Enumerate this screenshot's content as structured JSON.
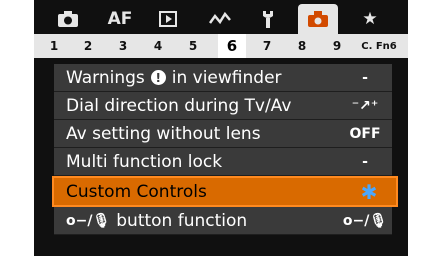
{
  "tabs": [
    {
      "name": "camera-icon",
      "label": ""
    },
    {
      "name": "af-tab",
      "label": "AF"
    },
    {
      "name": "playback-icon",
      "label": ""
    },
    {
      "name": "wave-icon",
      "label": ""
    },
    {
      "name": "wrench-icon",
      "label": ""
    },
    {
      "name": "custom-functions-icon",
      "label": "",
      "active": true
    },
    {
      "name": "star-icon",
      "label": "★"
    }
  ],
  "pages": [
    "1",
    "2",
    "3",
    "4",
    "5",
    "6",
    "7",
    "8",
    "9",
    "C. Fn6"
  ],
  "active_page": "6",
  "menu": {
    "items": [
      {
        "label_a": "Warnings",
        "label_b": "in viewfinder",
        "value": "-"
      },
      {
        "label": "Dial direction during Tv/Av",
        "value": "⁻↗⁺"
      },
      {
        "label": "Av setting without lens",
        "value": "OFF"
      },
      {
        "label": "Multi function lock",
        "value": "-"
      },
      {
        "label": "Custom Controls",
        "value": "✱",
        "selected": true
      },
      {
        "label": "button function",
        "value": "o−/🎙"
      }
    ]
  },
  "colors": {
    "accent": "#d96a00",
    "value_blue": "#4aa8ff"
  }
}
